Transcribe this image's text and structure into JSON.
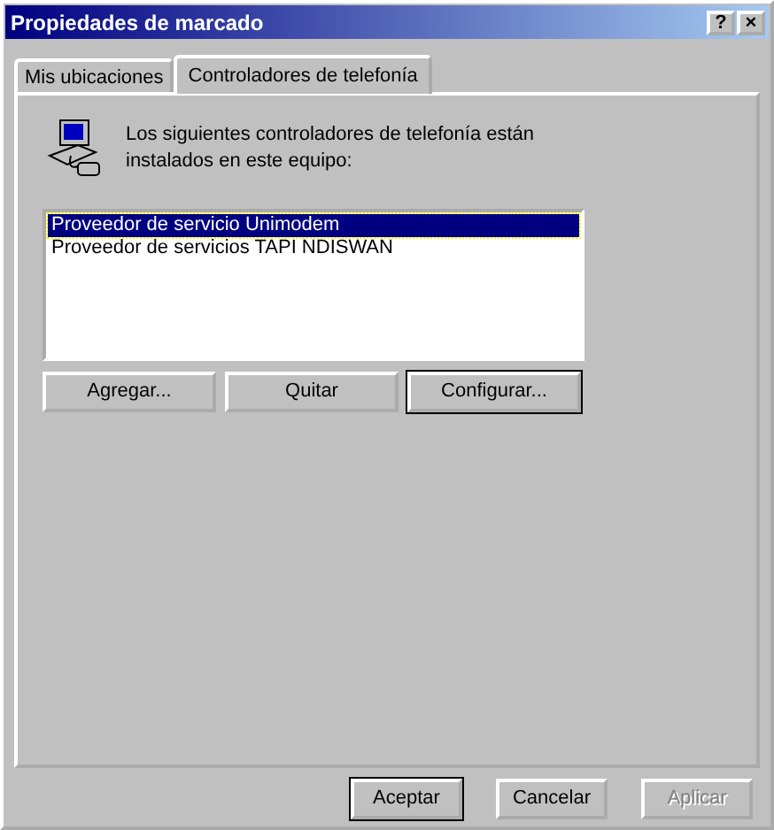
{
  "window": {
    "title": "Propiedades de marcado",
    "title_buttons": [
      "?",
      "×"
    ]
  },
  "tabs": [
    {
      "label": "Mis ubicaciones",
      "selected": false
    },
    {
      "label": "Controladores de telefonía",
      "selected": true
    }
  ],
  "description": "Los siguientes controladores de telefonía están instalados en este equipo:",
  "drivers": [
    {
      "label": "Proveedor de servicio Unimodem",
      "selected": true
    },
    {
      "label": "Proveedor de servicios TAPI NDISWAN",
      "selected": false
    }
  ],
  "driver_buttons": [
    {
      "label": "Agregar...",
      "default": false,
      "disabled": false
    },
    {
      "label": "Quitar",
      "default": false,
      "disabled": false
    },
    {
      "label": "Configurar...",
      "default": true,
      "disabled": false
    }
  ],
  "dialog_buttons": [
    {
      "label": "Aceptar",
      "default": true,
      "disabled": false
    },
    {
      "label": "Cancelar",
      "default": false,
      "disabled": false
    },
    {
      "label": "Aplicar",
      "default": false,
      "disabled": true
    }
  ]
}
